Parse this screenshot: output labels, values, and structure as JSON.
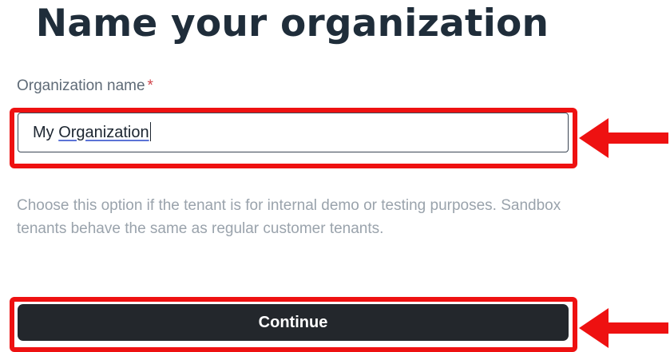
{
  "page": {
    "title": "Name your organization"
  },
  "form": {
    "org_name_label": "Organization name",
    "required_marker": "*",
    "org_name_value_prefix": "My ",
    "org_name_value_flagged": "Organization",
    "description": "Choose this option if the tenant is for internal demo or testing purposes. Sandbox tenants behave the same as regular customer tenants.",
    "continue_label": "Continue"
  },
  "annotations": {
    "highlight_color": "#ee1111",
    "highlighted_targets": [
      "organization-name-input",
      "continue-button"
    ]
  },
  "colors": {
    "title": "#1f2d3a",
    "required": "#d0454c",
    "button_background": "#23272c",
    "description_text": "#9aa3ac"
  }
}
